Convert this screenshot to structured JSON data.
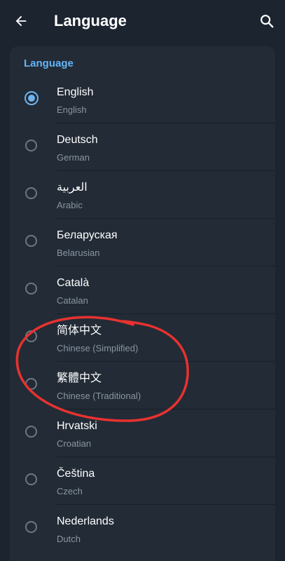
{
  "appbar": {
    "title": "Language",
    "back_icon": "arrow-left-icon",
    "search_icon": "search-icon"
  },
  "section": {
    "header": "Language"
  },
  "languages": [
    {
      "name": "English",
      "sub": "English",
      "selected": true
    },
    {
      "name": "Deutsch",
      "sub": "German",
      "selected": false
    },
    {
      "name": "العربية",
      "sub": "Arabic",
      "selected": false
    },
    {
      "name": "Беларуская",
      "sub": "Belarusian",
      "selected": false
    },
    {
      "name": "Català",
      "sub": "Catalan",
      "selected": false
    },
    {
      "name": "简体中文",
      "sub": "Chinese (Simplified)",
      "selected": false
    },
    {
      "name": "繁體中文",
      "sub": "Chinese (Traditional)",
      "selected": false
    },
    {
      "name": "Hrvatski",
      "sub": "Croatian",
      "selected": false
    },
    {
      "name": "Čeština",
      "sub": "Czech",
      "selected": false
    },
    {
      "name": "Nederlands",
      "sub": "Dutch",
      "selected": false
    }
  ],
  "colors": {
    "background": "#1c2430",
    "card": "#222b36",
    "accent": "#64b5f6",
    "annotation": "#e8322f"
  }
}
